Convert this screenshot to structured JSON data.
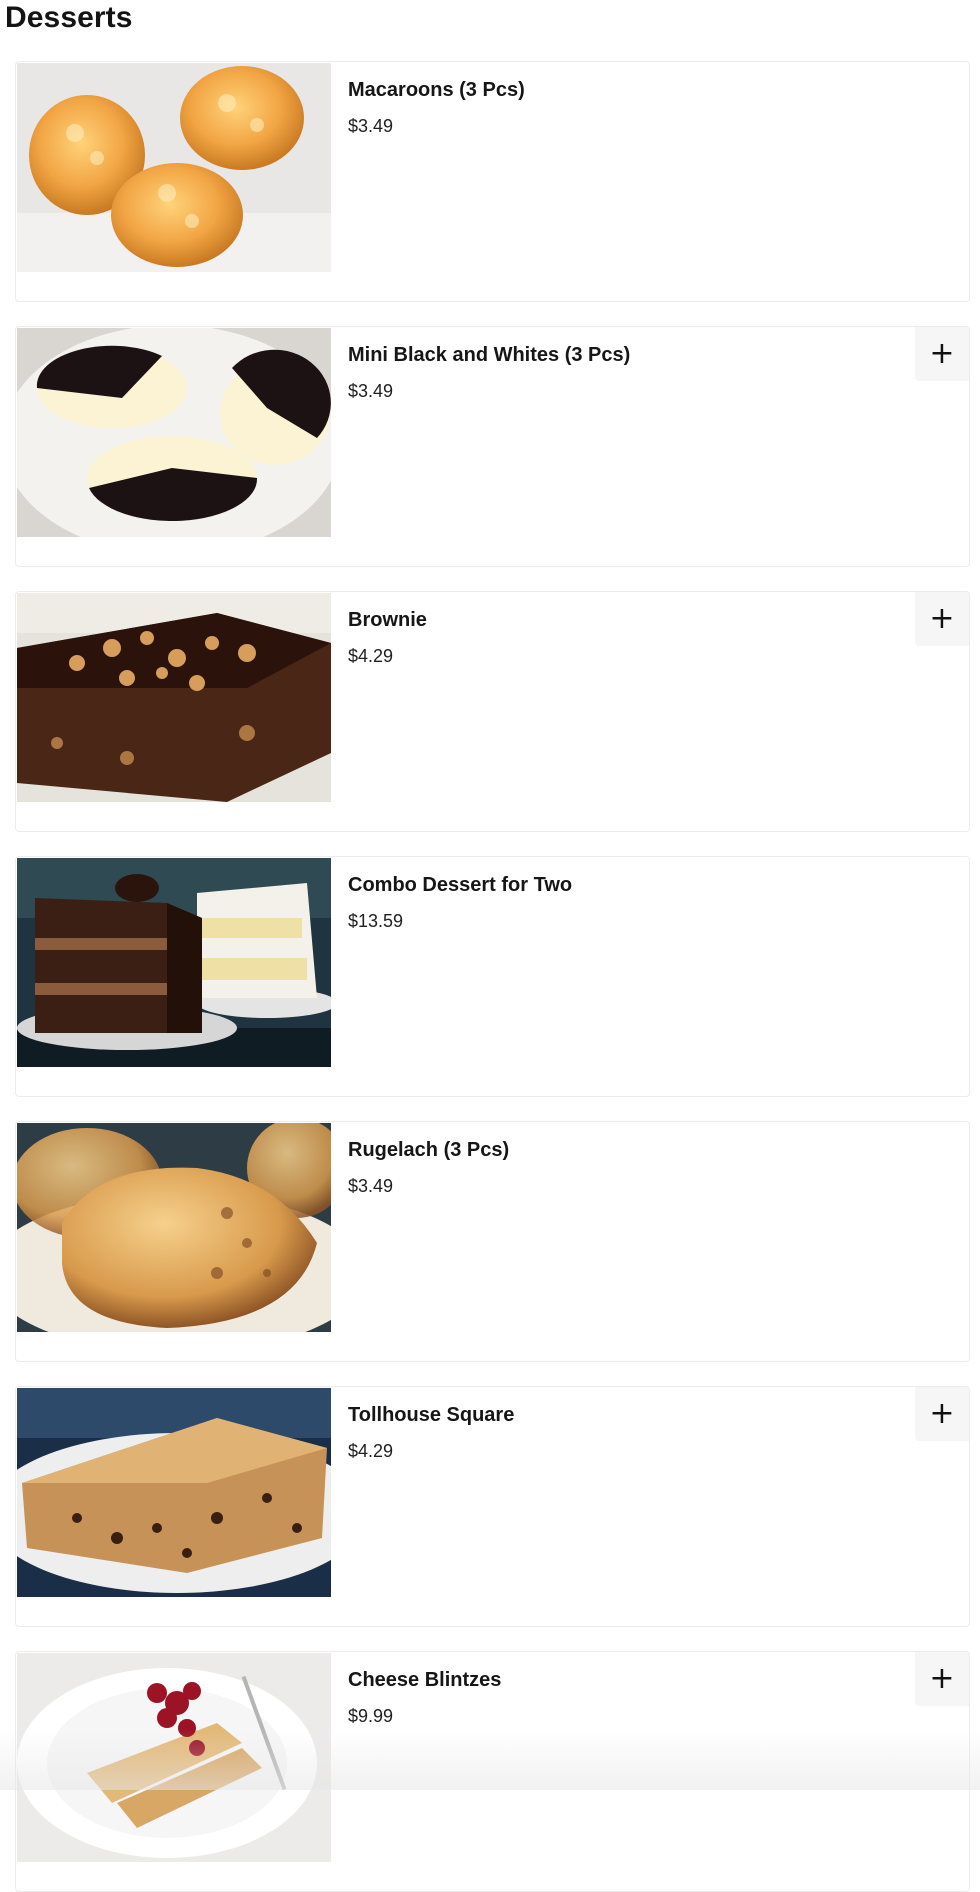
{
  "page": {
    "title": "Desserts"
  },
  "items": [
    {
      "name": "Macaroons (3 Pcs)",
      "price": "$3.49",
      "image": "macaroons-photo",
      "has_add_button": false
    },
    {
      "name": "Mini Black and Whites (3 Pcs)",
      "price": "$3.49",
      "image": "black-and-white-cookies-photo",
      "has_add_button": true
    },
    {
      "name": "Brownie",
      "price": "$4.29",
      "image": "brownie-photo",
      "has_add_button": true
    },
    {
      "name": "Combo Dessert for Two",
      "price": "$13.59",
      "image": "layer-cakes-photo",
      "has_add_button": false
    },
    {
      "name": "Rugelach (3 Pcs)",
      "price": "$3.49",
      "image": "rugelach-photo",
      "has_add_button": false
    },
    {
      "name": "Tollhouse Square",
      "price": "$4.29",
      "image": "tollhouse-bar-photo",
      "has_add_button": true
    },
    {
      "name": "Cheese Blintzes",
      "price": "$9.99",
      "image": "cheese-blintzes-photo",
      "has_add_button": true
    }
  ],
  "icons": {
    "add": "plus-icon",
    "add_glyph": "+"
  },
  "colors": {
    "card_border": "#ececec",
    "add_button_bg": "#f6f6f6",
    "text": "#141414"
  }
}
